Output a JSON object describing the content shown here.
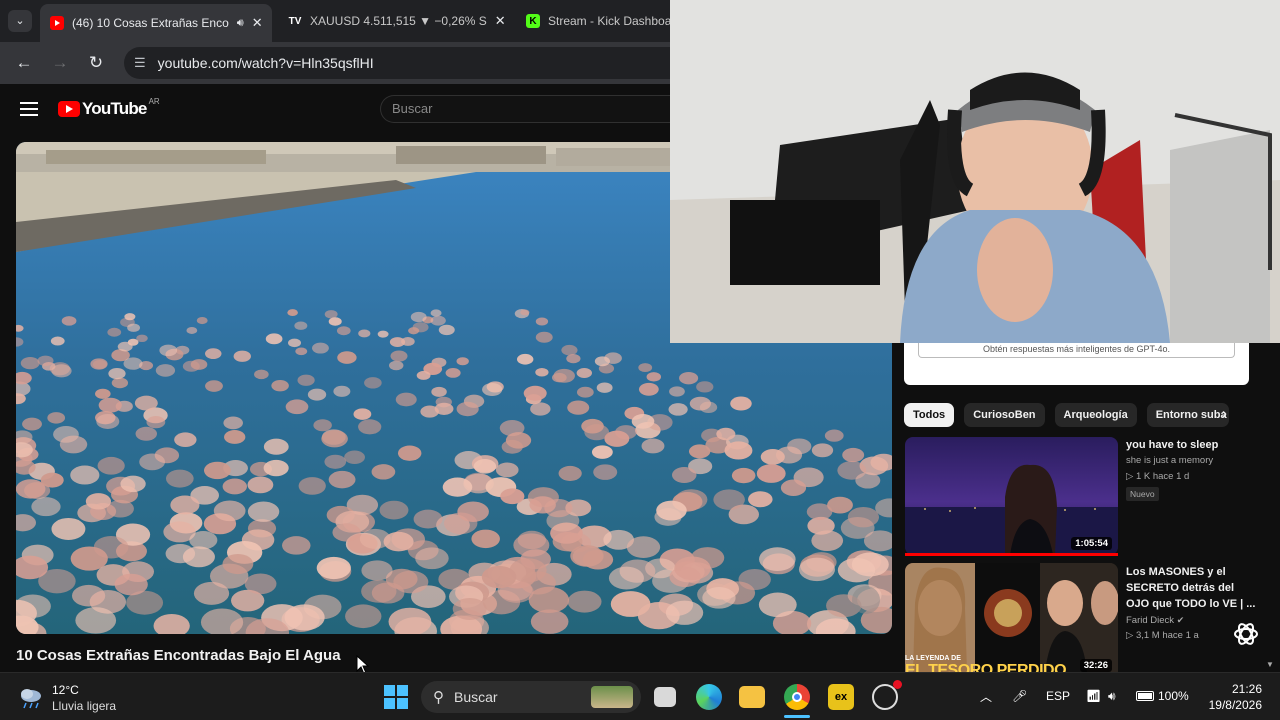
{
  "browser": {
    "tabs": [
      {
        "title": "(46) 10 Cosas Extrañas Enco",
        "favicon": "youtube-icon",
        "audio": true,
        "active": true
      },
      {
        "title": "XAUUSD 4.511,515 ▼ −0,26% S",
        "favicon": "tradingview-icon",
        "active": false
      },
      {
        "title": "Stream - Kick Dashboard",
        "favicon": "kick-icon",
        "active": false
      }
    ],
    "url": "youtube.com/watch?v=Hln35qsflHI"
  },
  "youtube": {
    "logo_text": "YouTube",
    "country": "AR",
    "search_placeholder": "Buscar",
    "video_title": "10 Cosas Extrañas Encontradas Bajo El Agua",
    "ad_text": "Obtén respuestas más inteligentes de GPT-4o.",
    "chips": [
      "Todos",
      "CuriosoBen",
      "Arqueología",
      "Entorno suba"
    ],
    "recommendations": [
      {
        "title": "you have to sleep",
        "channel": "she is just a memory",
        "meta": "▷ 1 K  hace 1 d",
        "badge": "Nuevo",
        "duration": "1:05:54"
      },
      {
        "title": "Los MASONES y el SECRETO detrás del OJO que TODO lo VE | ...",
        "channel": "Farid Dieck",
        "meta": "▷ 3,1 M  hace 1 a",
        "duration": "32:26",
        "thumb_text": "EL TESORO PERDIDO",
        "thumb_small": "LA LEYENDA DE"
      }
    ]
  },
  "taskbar": {
    "weather_temp": "12°C",
    "weather_desc": "Lluvia ligera",
    "search_placeholder": "Buscar",
    "language": "ESP",
    "battery": "100%",
    "time": "21:26",
    "date": "19/8/2026"
  },
  "colors": {
    "youtube_red": "#ff0000",
    "chrome_dark": "#202124",
    "accent_blue": "#4cc2ff"
  }
}
